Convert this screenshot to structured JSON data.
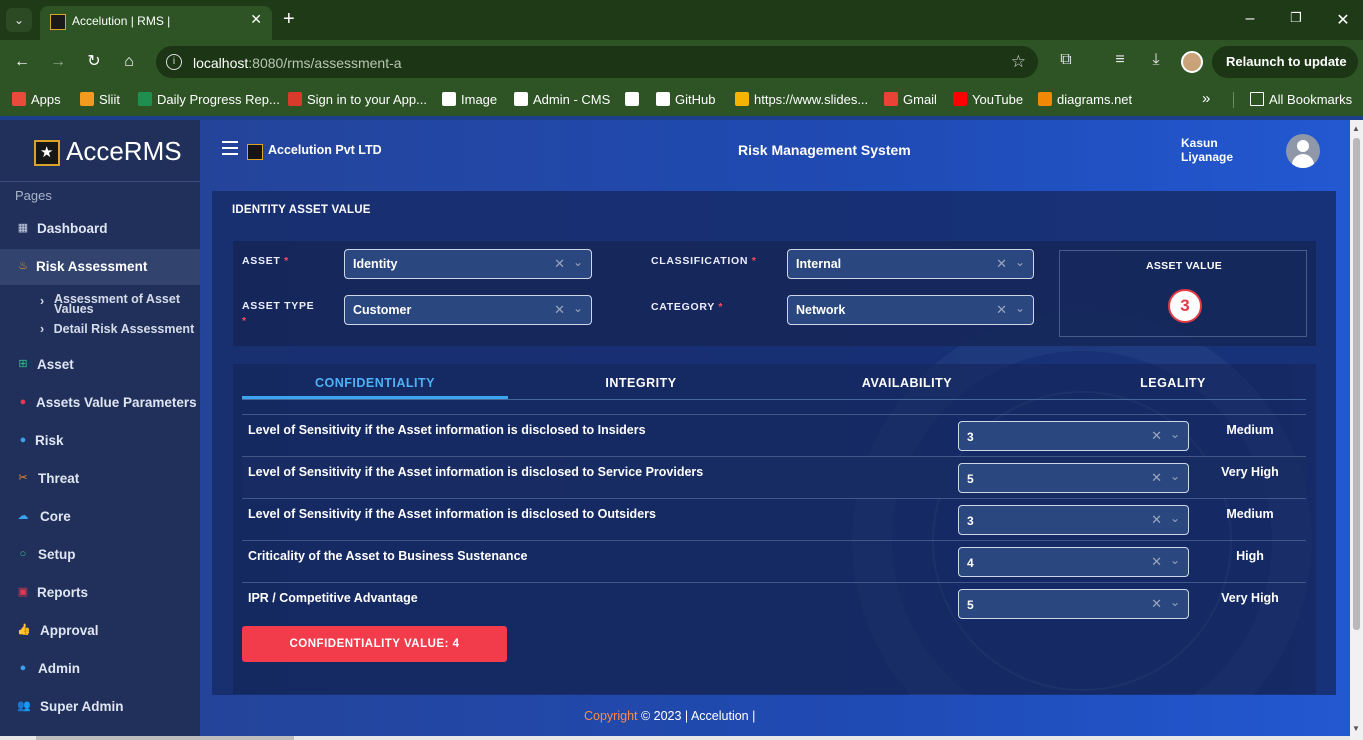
{
  "browser": {
    "tab_title": "Accelution | RMS |",
    "url_host": "localhost",
    "url_rest": ":8080/rms/assessment-a",
    "relaunch_label": "Relaunch to update",
    "bookmarks": [
      {
        "label": "Apps",
        "icon": "apps-grid-icon",
        "color": "#e84a3c"
      },
      {
        "label": "Sliit",
        "icon": "sliit-icon",
        "color": "#f39a1f"
      },
      {
        "label": "Daily Progress Rep...",
        "icon": "excel-icon",
        "color": "#1f8f4f"
      },
      {
        "label": "Sign in to your App...",
        "icon": "maple-leaf-icon",
        "color": "#d83b2b"
      },
      {
        "label": "Image",
        "icon": "globe-icon",
        "color": "#ffffff"
      },
      {
        "label": "Admin - CMS",
        "icon": "globe-icon",
        "color": "#ffffff"
      },
      {
        "label": "",
        "icon": "globe-icon",
        "color": "#ffffff"
      },
      {
        "label": "GitHub",
        "icon": "github-icon",
        "color": "#ffffff"
      },
      {
        "label": "https://www.slides...",
        "icon": "slides-icon",
        "color": "#f5b400"
      },
      {
        "label": "Gmail",
        "icon": "gmail-icon",
        "color": "#ea4335"
      },
      {
        "label": "YouTube",
        "icon": "youtube-icon",
        "color": "#ff0000"
      },
      {
        "label": "diagrams.net",
        "icon": "diagrams-icon",
        "color": "#f08705"
      }
    ],
    "all_bookmarks": "All Bookmarks"
  },
  "sidebar": {
    "logo": "AcceRMS",
    "section": "Pages",
    "items": [
      {
        "label": "Dashboard",
        "icon": "dashboard-icon",
        "color": "#c9d2e6"
      },
      {
        "label": "Risk Assessment",
        "icon": "flame-icon",
        "color": "#f0a020"
      },
      {
        "label": "Asset",
        "icon": "grid-icon",
        "color": "#38c08a"
      },
      {
        "label": "Assets Value Parameters",
        "icon": "bug-icon",
        "color": "#e23a50"
      },
      {
        "label": "Risk",
        "icon": "pin-icon",
        "color": "#3aa0f0"
      },
      {
        "label": "Threat",
        "icon": "scissors-icon",
        "color": "#f08a2a"
      },
      {
        "label": "Core",
        "icon": "cloud-icon",
        "color": "#3aa0f0"
      },
      {
        "label": "Setup",
        "icon": "refresh-icon",
        "color": "#38c08a"
      },
      {
        "label": "Reports",
        "icon": "report-icon",
        "color": "#e23a50"
      },
      {
        "label": "Approval",
        "icon": "thumbs-up-icon",
        "color": "#38c08a"
      },
      {
        "label": "Admin",
        "icon": "user-circle-icon",
        "color": "#3aa0f0"
      },
      {
        "label": "Super Admin",
        "icon": "users-icon",
        "color": "#f0a020"
      }
    ],
    "sub_items": [
      "Assessment of Asset Values",
      "Detail Risk Assessment"
    ]
  },
  "header": {
    "company": "Accelution Pvt LTD",
    "system_title": "Risk Management System",
    "user_name": "Kasun Liyanage"
  },
  "panel": {
    "title": "IDENTITY ASSET VALUE",
    "fields": {
      "asset_label": "ASSET",
      "asset_value": "Identity",
      "asset_type_label": "ASSET TYPE",
      "asset_type_value": "Customer",
      "classification_label": "CLASSIFICATION",
      "classification_value": "Internal",
      "category_label": "CATEGORY",
      "category_value": "Network"
    },
    "asset_value_label": "ASSET VALUE",
    "asset_value": "3",
    "tabs": [
      "CONFIDENTIALITY",
      "INTEGRITY",
      "AVAILABILITY",
      "LEGALITY"
    ],
    "rows": [
      {
        "label": "Level of Sensitivity if the Asset information is disclosed to Insiders",
        "value": "3",
        "rating": "Medium"
      },
      {
        "label": "Level of Sensitivity if the Asset information is disclosed to Service Providers",
        "value": "5",
        "rating": "Very High"
      },
      {
        "label": "Level of Sensitivity if the Asset information is disclosed to Outsiders",
        "value": "3",
        "rating": "Medium"
      },
      {
        "label": "Criticality of the Asset to Business Sustenance",
        "value": "4",
        "rating": "High"
      },
      {
        "label": "IPR / Competitive Advantage",
        "value": "5",
        "rating": "Very High"
      }
    ],
    "confidentiality_value": "CONFIDENTIALITY VALUE: 4"
  },
  "footer": {
    "copyright_word": "Copyright",
    "rest": " © 2023 | Accelution |"
  }
}
